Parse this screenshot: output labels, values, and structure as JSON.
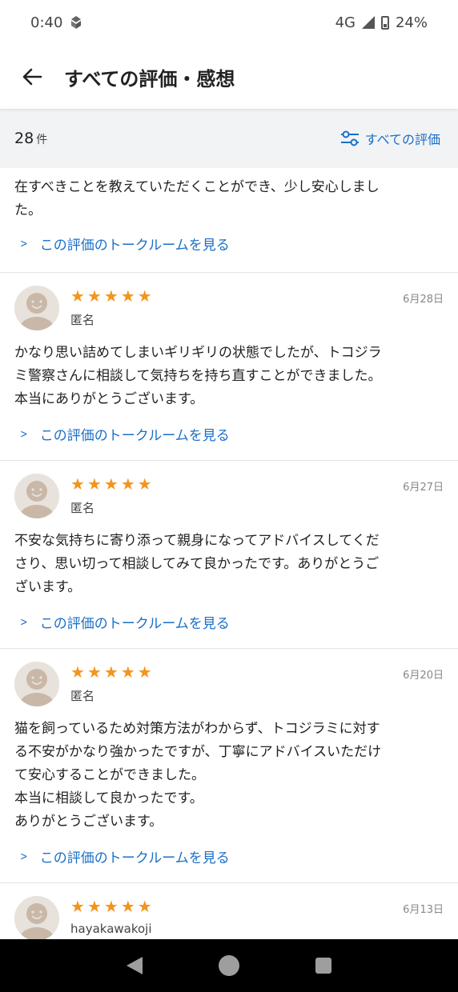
{
  "status_bar": {
    "time": "0:40",
    "network": "4G",
    "battery": "24%"
  },
  "header": {
    "title": "すべての評価・感想"
  },
  "summary": {
    "count": "28",
    "count_unit": "件",
    "filter_label": "すべての評価"
  },
  "colors": {
    "star": "#f3941d",
    "link": "#1a6fc8"
  },
  "reviews": [
    {
      "partial": true,
      "text_lines": [
        "在すべきことを教えていただくことができ、少し安心しまし",
        "た。"
      ],
      "link": "この評価のトークルームを見る"
    },
    {
      "rating": 5,
      "date": "6月28日",
      "author": "匿名",
      "text_lines": [
        "かなり思い詰めてしまいギリギリの状態でしたが、トコジラ",
        "ミ警察さんに相談して気持ちを持ち直すことができました。",
        "本当にありがとうございます。"
      ],
      "link": "この評価のトークルームを見る"
    },
    {
      "rating": 5,
      "date": "6月27日",
      "author": "匿名",
      "text_lines": [
        "不安な気持ちに寄り添って親身になってアドバイスしてくだ",
        "さり、思い切って相談してみて良かったです。ありがとうご",
        "ざいます。"
      ],
      "link": "この評価のトークルームを見る"
    },
    {
      "rating": 5,
      "date": "6月20日",
      "author": "匿名",
      "text_lines": [
        "猫を飼っているため対策方法がわからず、トコジラミに対す",
        "る不安がかなり強かったですが、丁寧にアドバイスいただけ",
        "て安心することができました。",
        "本当に相談して良かったです。",
        "ありがとうございます。"
      ],
      "link": "この評価のトークルームを見る"
    },
    {
      "rating": 5,
      "date": "6月13日",
      "author": "hayakawakoji"
    }
  ]
}
